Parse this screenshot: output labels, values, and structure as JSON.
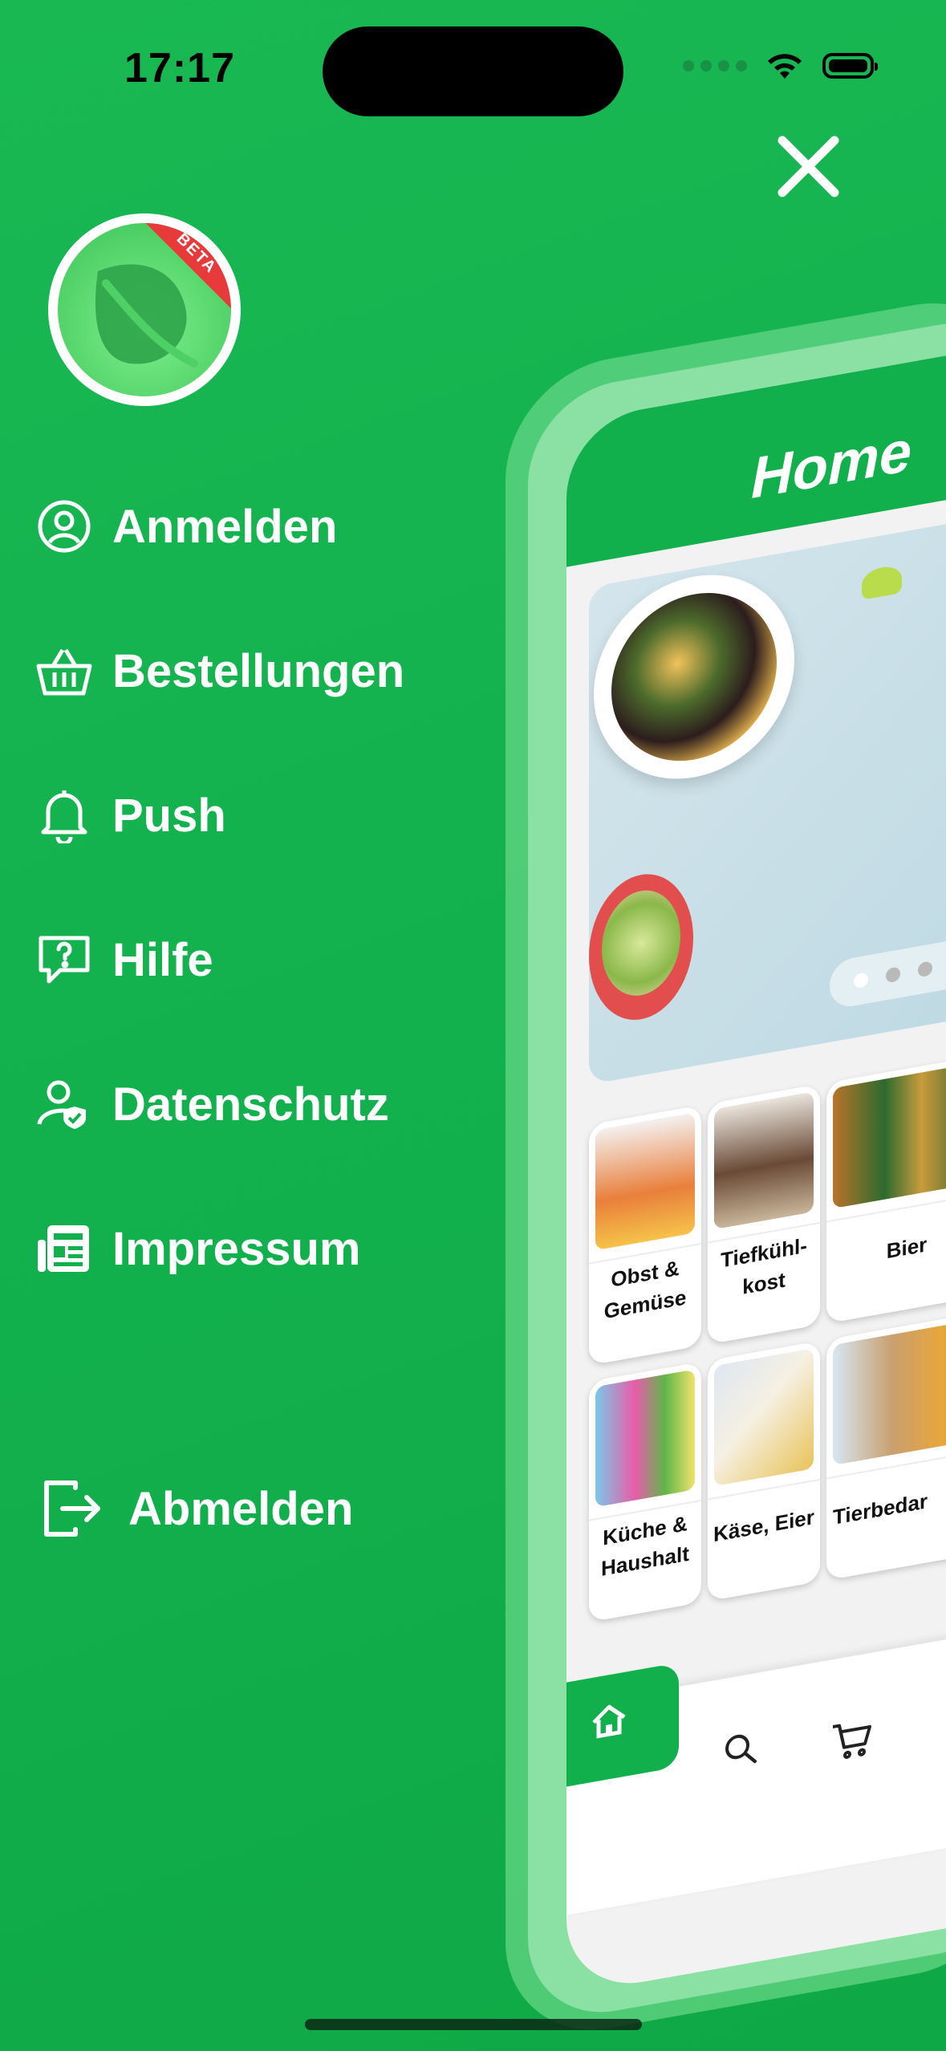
{
  "status_bar": {
    "time": "17:17"
  },
  "menu": {
    "items": [
      {
        "label": "Anmelden",
        "icon": "user-circle-icon"
      },
      {
        "label": "Bestellungen",
        "icon": "basket-icon"
      },
      {
        "label": "Push",
        "icon": "bell-icon"
      },
      {
        "label": "Hilfe",
        "icon": "help-bubble-icon"
      },
      {
        "label": "Datenschutz",
        "icon": "user-shield-icon"
      },
      {
        "label": "Impressum",
        "icon": "newspaper-icon"
      }
    ],
    "logout_label": "Abmelden"
  },
  "avatar": {
    "badge": "BETA"
  },
  "preview": {
    "title": "Home",
    "categories": [
      {
        "label": "Obst & Gemüse"
      },
      {
        "label": "Tiefkühl-kost"
      },
      {
        "label": "Bier"
      },
      {
        "label": "Küche & Haushalt"
      },
      {
        "label": "Käse, Eier"
      },
      {
        "label": "Tierbedar"
      }
    ],
    "tabs": [
      "home-icon",
      "search-icon",
      "cart-icon"
    ]
  },
  "colors": {
    "brand_green": "#12b04d",
    "accent_red": "#e83a3a"
  }
}
